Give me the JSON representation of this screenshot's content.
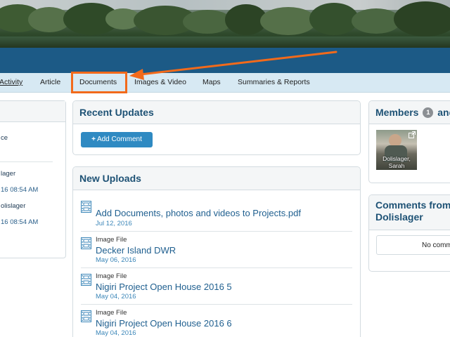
{
  "tabs": [
    {
      "label": "Activity"
    },
    {
      "label": "Article"
    },
    {
      "label": "Documents"
    },
    {
      "label": "Images & Video"
    },
    {
      "label": "Maps"
    },
    {
      "label": "Summaries & Reports"
    }
  ],
  "left_panel": {
    "items": [
      "ce",
      "lager",
      "16 08:54 AM",
      "olislager",
      "16 08:54 AM"
    ]
  },
  "recent_updates": {
    "title": "Recent Updates",
    "add_comment_label": "Add Comment"
  },
  "new_uploads": {
    "title": "New Uploads",
    "items": [
      {
        "type": "",
        "title": "Add Documents, photos and videos to Projects.pdf",
        "date": "Jul 12, 2016"
      },
      {
        "type": "Image File",
        "title": "Decker Island DWR",
        "date": "May 06, 2016"
      },
      {
        "type": "Image File",
        "title": "Nigiri Project Open House 2016 5",
        "date": "May 04, 2016"
      },
      {
        "type": "Image File",
        "title": "Nigiri Project Open House 2016 6",
        "date": "May 04, 2016"
      }
    ]
  },
  "members": {
    "title_prefix": "Members",
    "count": "1",
    "title_suffix": "and",
    "member_name": "Dolislager, Sarah"
  },
  "comments": {
    "title_line1": "Comments from",
    "title_line2": "Dolislager",
    "empty_text": "No comm"
  },
  "colors": {
    "accent": "#1c5a86",
    "highlight": "#f26a1b",
    "tabs_bg": "#d7e9f3",
    "button": "#2f8ac2"
  },
  "icons": {
    "upload_icon": "film-icon",
    "add_icon": "plus-icon",
    "member_action_icon": "external-link-icon"
  }
}
